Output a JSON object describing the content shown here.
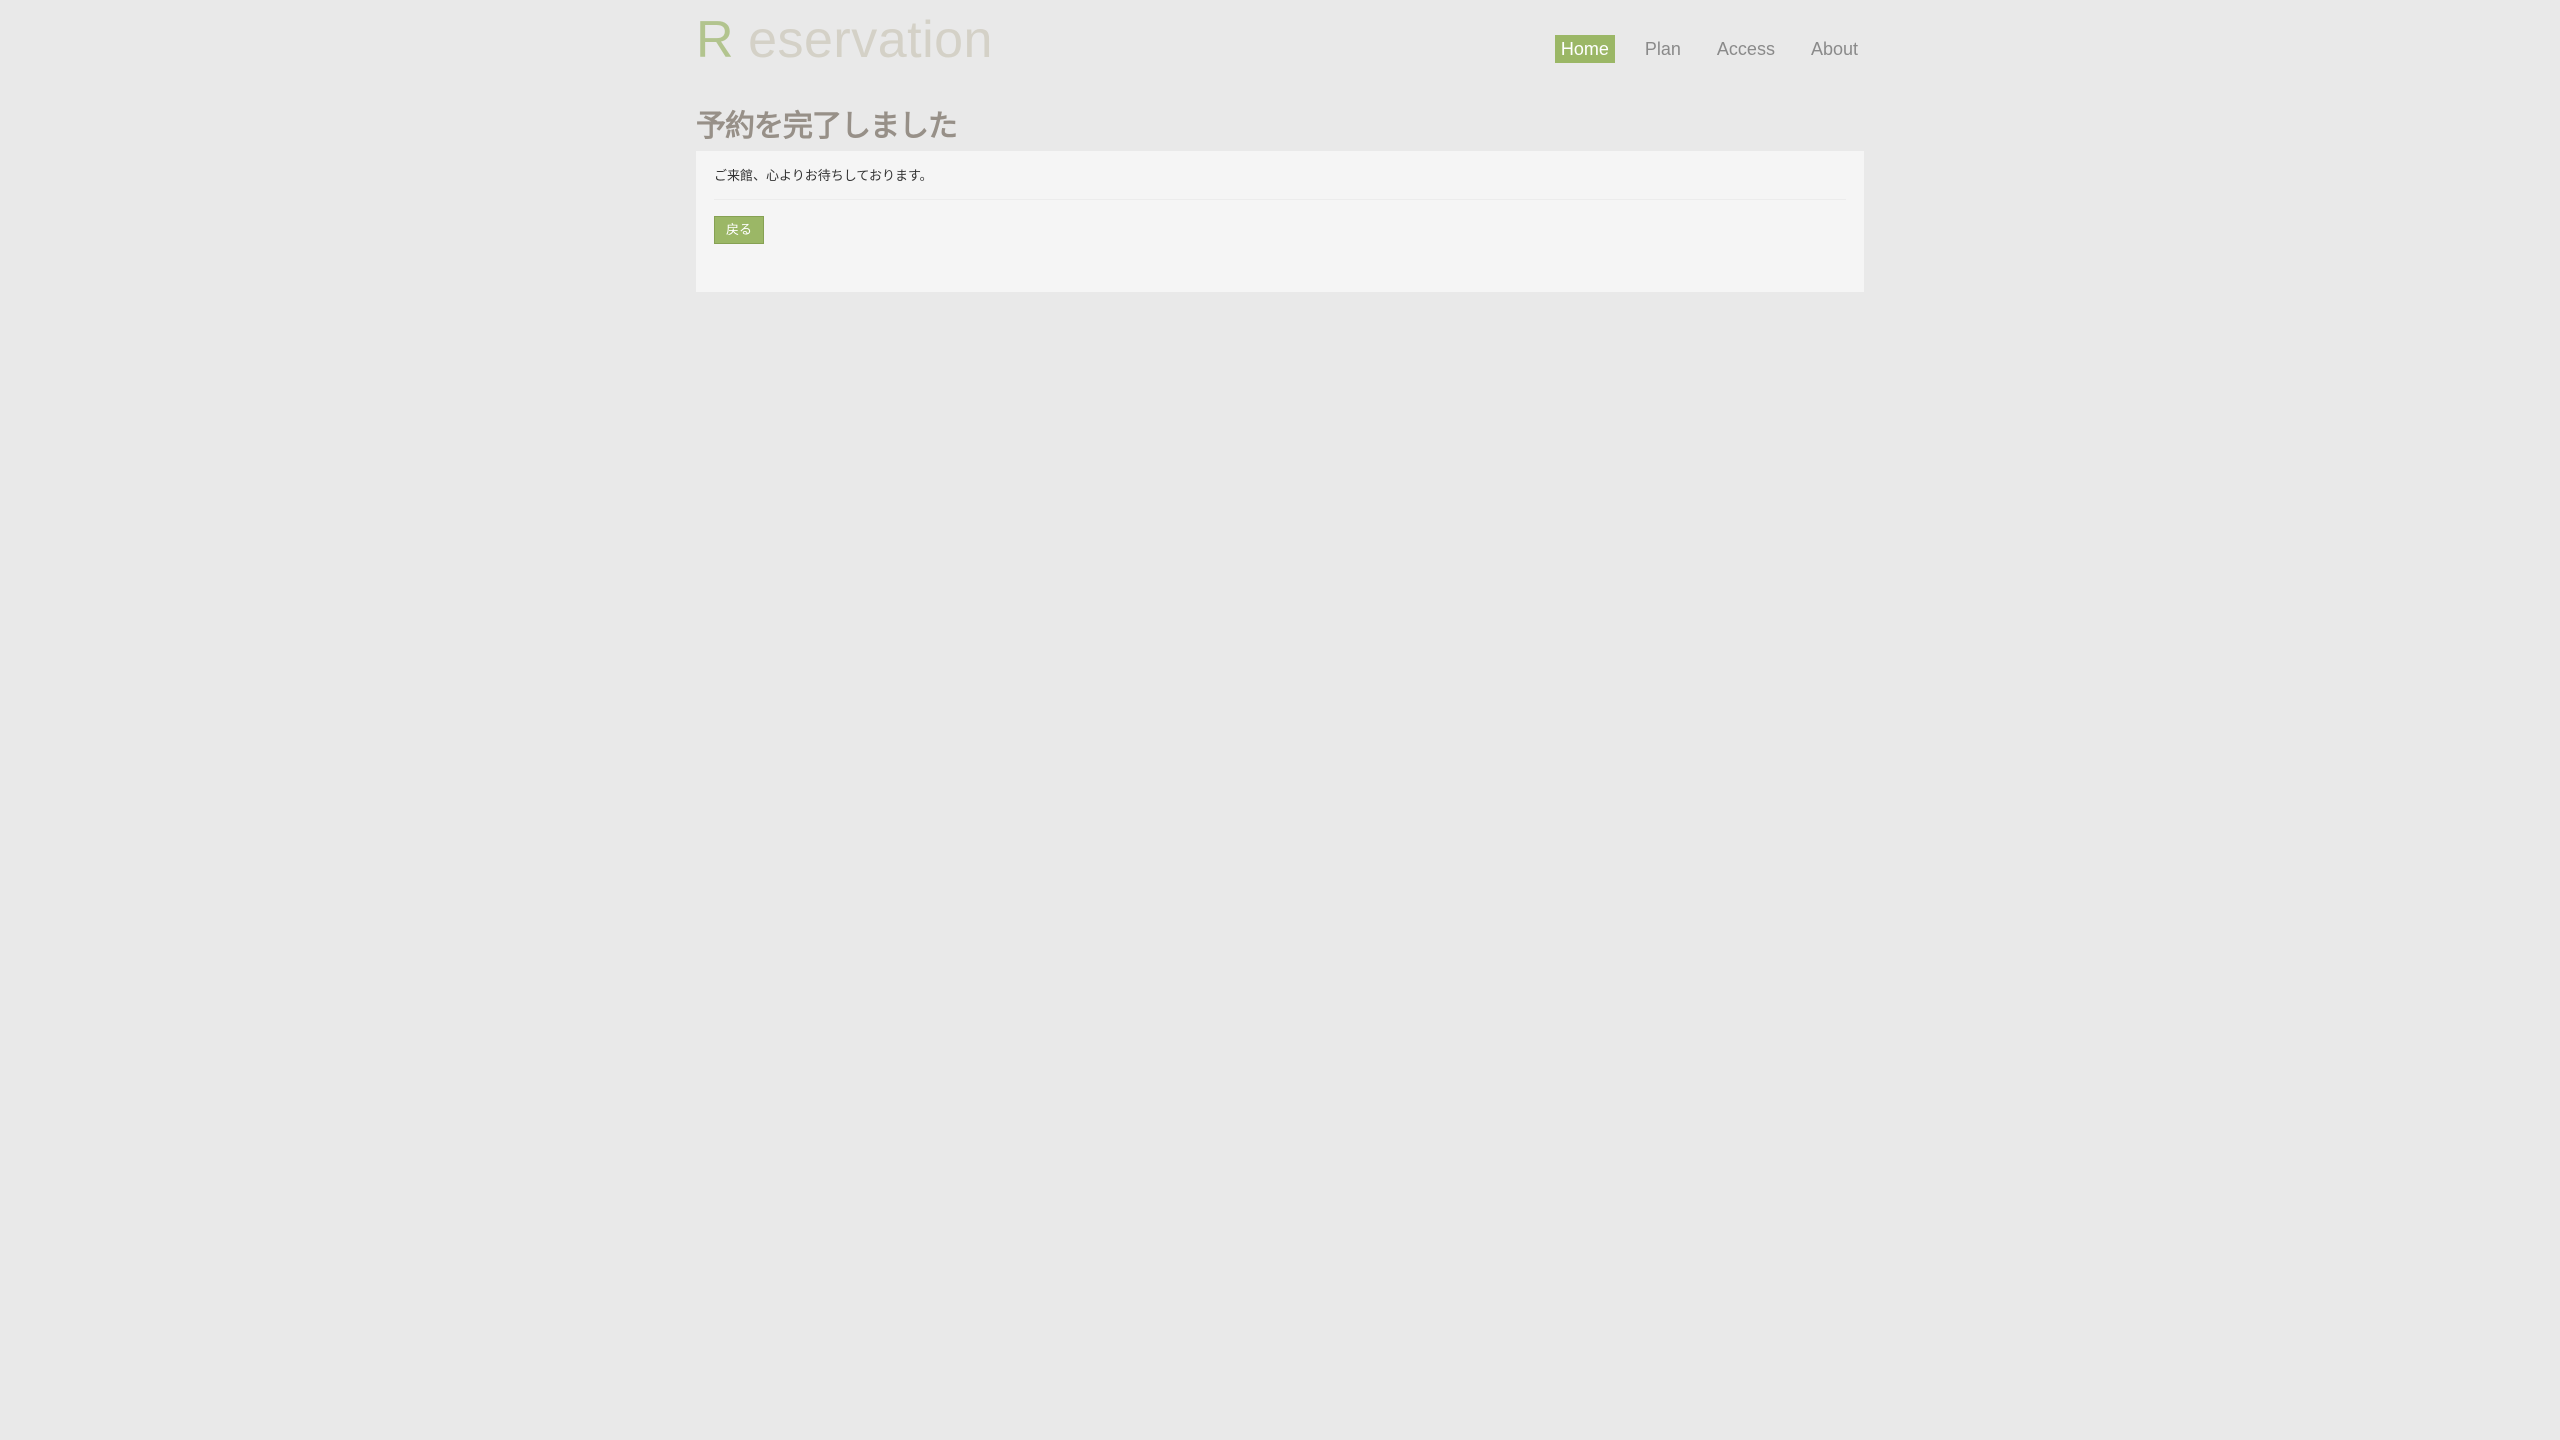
{
  "header": {
    "logo_initial": "R",
    "logo_rest": "eservation",
    "nav": [
      {
        "label": "Home",
        "active": true
      },
      {
        "label": "Plan",
        "active": false
      },
      {
        "label": "Access",
        "active": false
      },
      {
        "label": "About",
        "active": false
      }
    ]
  },
  "main": {
    "title": "予約を完了しました",
    "message": "ご来館、心よりお待ちしております。",
    "back_button_label": "戻る"
  },
  "colors": {
    "accent": "#9bb766",
    "background": "#e9e9e9",
    "panel": "#f5f5f5",
    "title": "#979088"
  }
}
